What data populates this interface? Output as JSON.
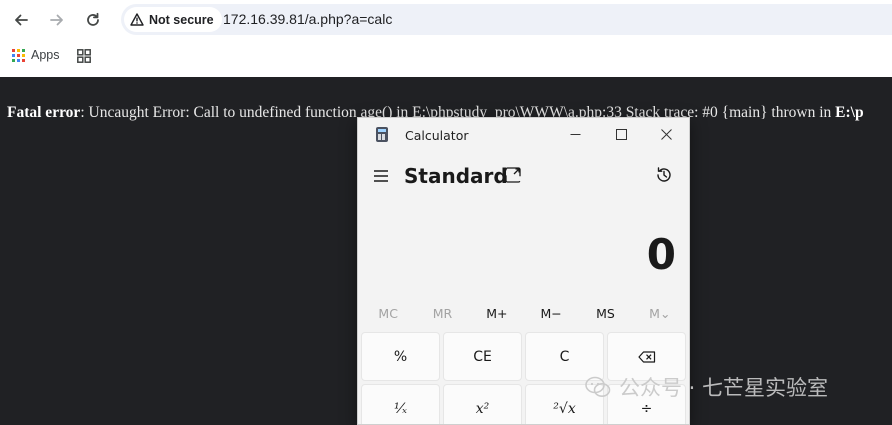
{
  "browser": {
    "security_label": "Not secure",
    "url": "172.16.39.81/a.php?a=calc",
    "bookmarks": {
      "apps_label": "Apps"
    }
  },
  "page": {
    "error": {
      "bold_prefix": "Fatal error",
      "message": ": Uncaught Error: Call to undefined function age() in E:\\phpstudy_pro\\WWW\\a.php:33 Stack trace: #0 {main} thrown in ",
      "bold_suffix": "E:\\p"
    }
  },
  "calculator": {
    "title": "Calculator",
    "mode": "Standard",
    "display": "0",
    "memory_buttons": [
      "MC",
      "MR",
      "M+",
      "M−",
      "MS",
      "M⌄"
    ],
    "keys_row1": [
      "%",
      "CE",
      "C",
      "backspace"
    ],
    "keys_row2": [
      "¹⁄ₓ",
      "x²",
      "²√x",
      "÷"
    ]
  },
  "watermark": {
    "text": "公众号 · 七芒星实验室"
  }
}
